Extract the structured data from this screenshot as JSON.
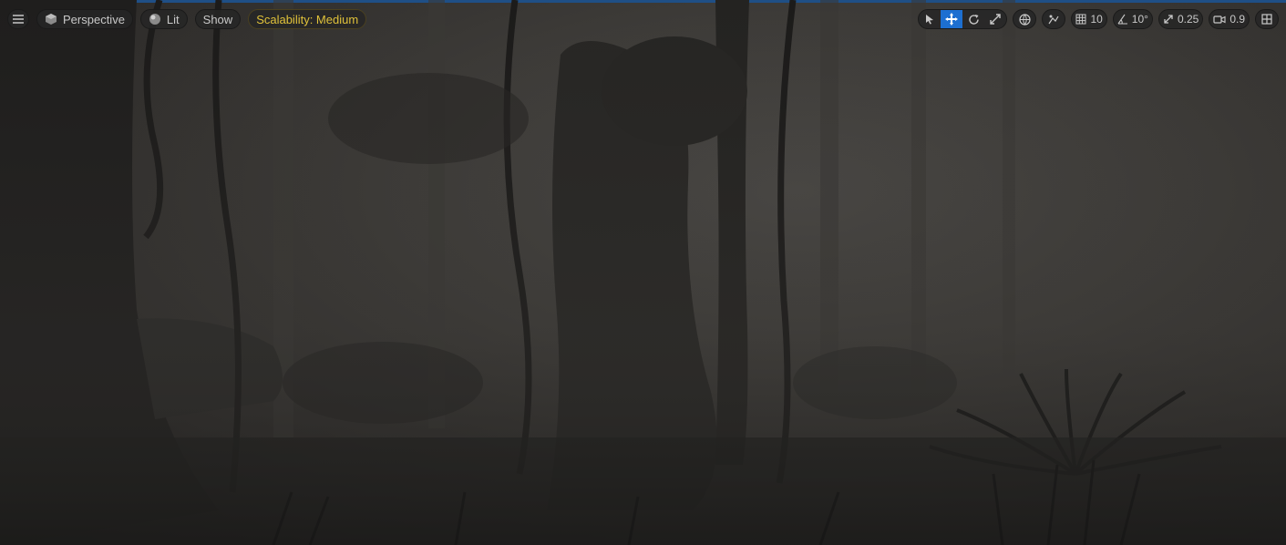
{
  "toolbar_left": {
    "menu_icon": "hamburger-icon",
    "perspective_label": "Perspective",
    "lit_label": "Lit",
    "show_label": "Show",
    "scalability_label": "Scalability: Medium"
  },
  "toolbar_right": {
    "select_icon": "cursor-icon",
    "translate_icon": "move-icon",
    "rotate_icon": "rotate-icon",
    "scale_icon": "scale-icon",
    "world_icon": "globe-icon",
    "surface_snap_icon": "surface-snap-icon",
    "grid_snap_value": "10",
    "rotation_snap_value": "10°",
    "scale_snap_value": "0.25",
    "camera_speed_value": "0.9",
    "layout_icon": "viewport-layout-icon"
  },
  "colors": {
    "accent": "#1d6fd1",
    "warning": "#e0c23a"
  }
}
